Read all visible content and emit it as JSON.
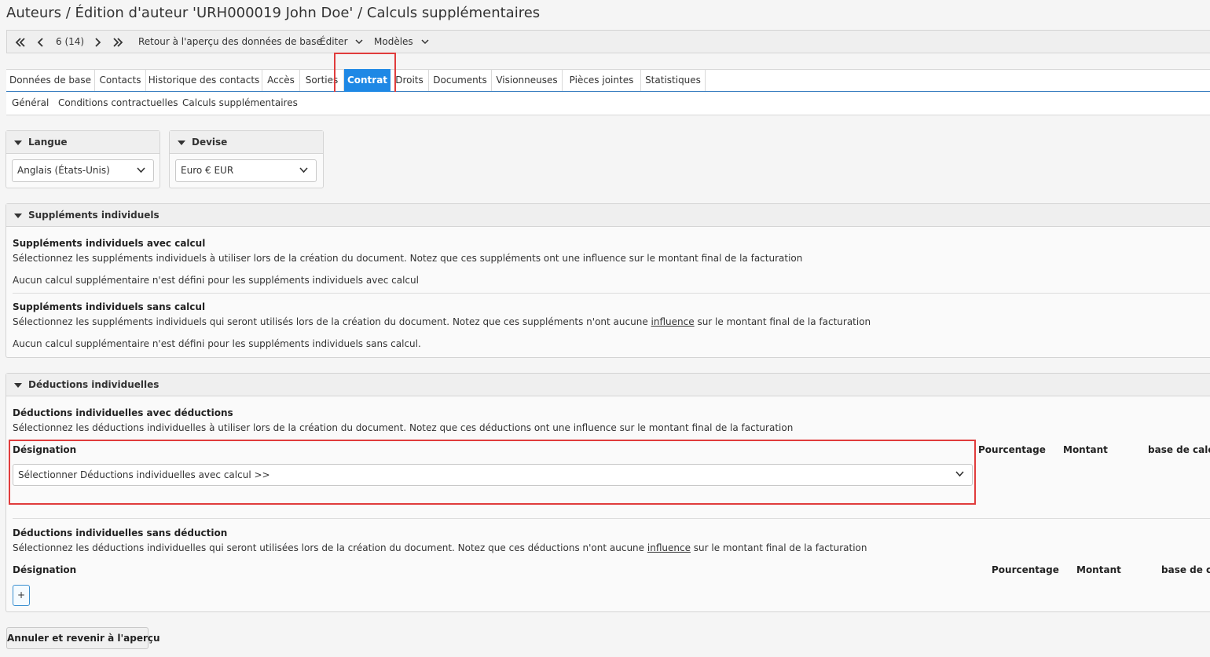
{
  "page_title": "Auteurs / Édition d'auteur 'URH000019 John Doe' / Calculs supplémentaires",
  "toolbar": {
    "record_position": "6 (14)",
    "back_label": "Retour à l'aperçu des données de base",
    "edit_label": "Éditer",
    "templates_label": "Modèles"
  },
  "tabs": [
    {
      "label": "Données de base"
    },
    {
      "label": "Contacts"
    },
    {
      "label": "Historique des contacts"
    },
    {
      "label": "Accès"
    },
    {
      "label": "Sorties"
    },
    {
      "label": "Contrat",
      "active": true
    },
    {
      "label": "Droits"
    },
    {
      "label": "Documents"
    },
    {
      "label": "Visionneuses"
    },
    {
      "label": "Pièces jointes"
    },
    {
      "label": "Statistiques"
    }
  ],
  "subtabs": [
    {
      "label": "Général"
    },
    {
      "label": "Conditions contractuelles"
    },
    {
      "label": "Calculs supplémentaires"
    }
  ],
  "language_panel": {
    "title": "Langue",
    "value": "Anglais (États-Unis)"
  },
  "currency_panel": {
    "title": "Devise",
    "value": "Euro € EUR"
  },
  "supplements": {
    "title": "Suppléments individuels",
    "with_calc": {
      "heading": "Suppléments individuels avec calcul",
      "description": "Sélectionnez les suppléments individuels à utiliser lors de la création du document. Notez que ces suppléments ont une influence sur le montant final de la facturation",
      "empty": "Aucun calcul supplémentaire n'est défini pour les suppléments individuels avec calcul"
    },
    "without_calc": {
      "heading": "Suppléments individuels sans calcul",
      "description_before": "Sélectionnez les suppléments individuels qui seront utilisés lors de la création du document. Notez que ces suppléments n'ont aucune",
      "description_link": "influence",
      "description_after": "sur le montant final de la facturation",
      "empty": "Aucun calcul supplémentaire n'est défini pour les suppléments individuels sans calcul."
    }
  },
  "deductions": {
    "title": "Déductions individuelles",
    "with": {
      "heading": "Déductions individuelles avec déductions",
      "description": "Sélectionnez les déductions individuelles à utiliser lors de la création du document. Notez que ces déductions ont une influence sur le montant final de la facturation",
      "col_designation": "Désignation",
      "col_percentage": "Pourcentage",
      "col_amount": "Montant",
      "col_base": "base de calcu",
      "select_placeholder": "Sélectionner Déductions individuelles avec calcul >>"
    },
    "without": {
      "heading": "Déductions individuelles sans déduction",
      "description_before": "Sélectionnez les déductions individuelles qui seront utilisées lors de la création du document. Notez que ces déductions n'ont aucune",
      "description_link": "influence",
      "description_after": "sur le montant final de la facturation",
      "col_designation": "Désignation",
      "col_percentage": "Pourcentage",
      "col_amount": "Montant",
      "col_base": "base de cal",
      "add_label": "+"
    }
  },
  "cancel_button": "Annuler et revenir à l'aperçu",
  "colors": {
    "accent": "#1e88e5",
    "highlight": "#e03c3c"
  }
}
